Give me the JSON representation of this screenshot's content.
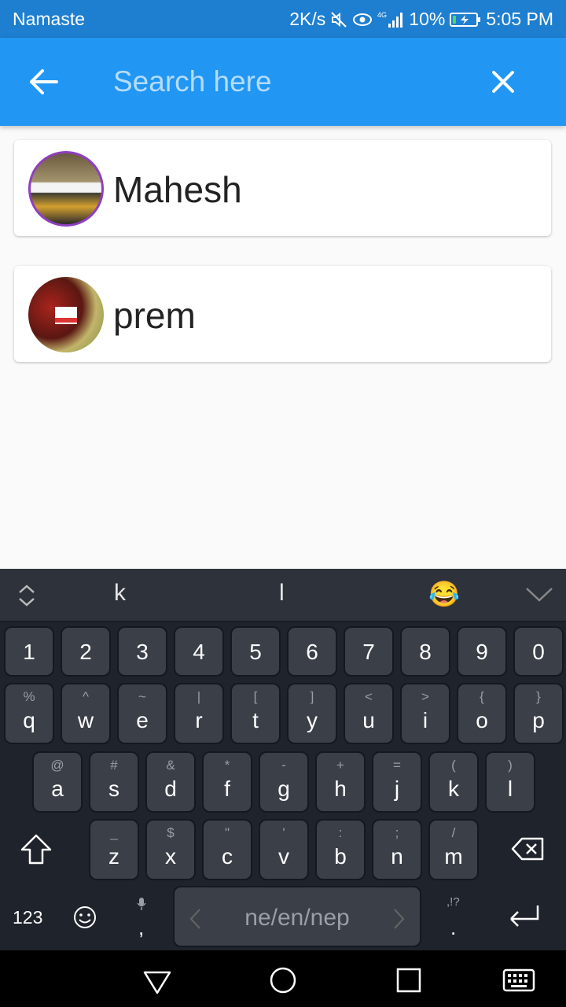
{
  "status_bar": {
    "carrier": "Namaste",
    "speed": "2K/s",
    "network": "4G",
    "battery": "10%",
    "time": "5:05 PM"
  },
  "app_bar": {
    "back_icon": "arrow-left-icon",
    "search_placeholder": "Search here",
    "search_value": "",
    "clear_icon": "close-icon"
  },
  "results": [
    {
      "name": "Mahesh",
      "avatar": "photo"
    },
    {
      "name": "prem",
      "avatar": "photo"
    }
  ],
  "keyboard": {
    "suggestions": [
      "k",
      "l"
    ],
    "emoji": "😂",
    "number_row": [
      "1",
      "2",
      "3",
      "4",
      "5",
      "6",
      "7",
      "8",
      "9",
      "0"
    ],
    "row1": [
      {
        "main": "q",
        "alt": "%"
      },
      {
        "main": "w",
        "alt": "^"
      },
      {
        "main": "e",
        "alt": "~"
      },
      {
        "main": "r",
        "alt": "|"
      },
      {
        "main": "t",
        "alt": "["
      },
      {
        "main": "y",
        "alt": "]"
      },
      {
        "main": "u",
        "alt": "<"
      },
      {
        "main": "i",
        "alt": ">"
      },
      {
        "main": "o",
        "alt": "{"
      },
      {
        "main": "p",
        "alt": "}"
      }
    ],
    "row2": [
      {
        "main": "a",
        "alt": "@"
      },
      {
        "main": "s",
        "alt": "#"
      },
      {
        "main": "d",
        "alt": "&"
      },
      {
        "main": "f",
        "alt": "*"
      },
      {
        "main": "g",
        "alt": "-"
      },
      {
        "main": "h",
        "alt": "+"
      },
      {
        "main": "j",
        "alt": "="
      },
      {
        "main": "k",
        "alt": "("
      },
      {
        "main": "l",
        "alt": ")"
      }
    ],
    "row3": [
      {
        "main": "z",
        "alt": "_"
      },
      {
        "main": "x",
        "alt": "$"
      },
      {
        "main": "c",
        "alt": "\""
      },
      {
        "main": "v",
        "alt": "'"
      },
      {
        "main": "b",
        "alt": ":"
      },
      {
        "main": "n",
        "alt": ";"
      },
      {
        "main": "m",
        "alt": "/"
      }
    ],
    "numbers_label": "123",
    "mic_comma": ",",
    "space_label": "ne/en/nep",
    "period_alt": ",!?",
    "period": "."
  },
  "colors": {
    "status_bar": "#1e7fd1",
    "app_bar": "#2196f3",
    "keyboard_bg": "#1f232b",
    "key_bg": "#3b3f48"
  }
}
